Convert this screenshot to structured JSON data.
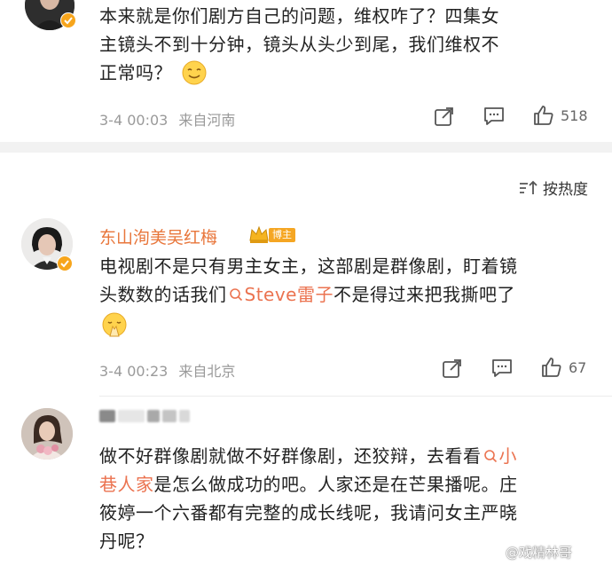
{
  "comment1": {
    "text_line1": "本来就是你们剧方自己的问题，维权咋了？四集女",
    "text_line2": "主镜头不到十分钟，镜头从头少到尾，我们维权不",
    "text_line3": "正常吗？",
    "time": "3-4 00:03",
    "location": "来自河南",
    "likes": "518"
  },
  "sort": {
    "label": "按热度"
  },
  "comment2": {
    "username": "东山洵美吴红梅",
    "badge": "博主",
    "text_line1": "电视剧不是只有男主女主，这部剧是群像剧，盯着镜",
    "text_line2_a": "头数数的话我们",
    "mention": "Steve雷子",
    "text_line2_b": "不是得过来把我撕吧了",
    "time": "3-4 00:23",
    "location": "来自北京",
    "likes": "67"
  },
  "comment3": {
    "text_line1_a": "做不好群像剧就做不好群像剧，还狡辩，去看看",
    "mention_a": "小",
    "mention_b": "巷人家",
    "text_line2_b": "是怎么做成功的吧。人家还是在芒果播呢。庄",
    "text_line3": "筱婷一个六番都有完整的成长线呢，我请问女主严晓",
    "text_line4": "丹呢？"
  },
  "watermark": "@戏精林哥",
  "colors": {
    "accent": "#eb7350",
    "username": "#e8763b",
    "meta": "#9a9a9a",
    "divider": "#f2f2f2"
  }
}
